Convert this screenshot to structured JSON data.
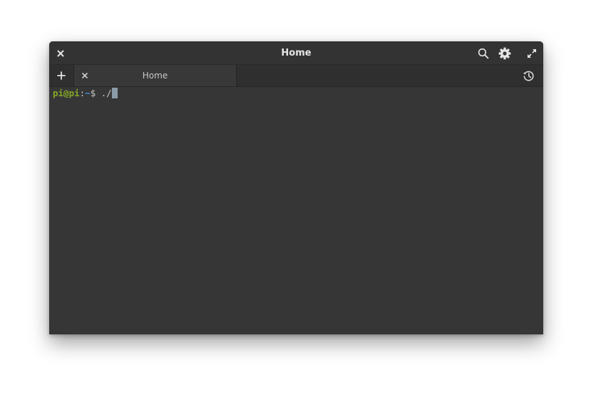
{
  "window": {
    "title": "Home"
  },
  "titlebar": {
    "close_icon": "close-icon",
    "search_icon": "search-icon",
    "settings_icon": "gear-icon",
    "maximize_icon": "maximize-icon"
  },
  "tabbar": {
    "new_tab_icon": "plus-icon",
    "tabs": [
      {
        "label": "Home",
        "close_icon": "close-icon"
      }
    ],
    "history_icon": "history-icon"
  },
  "terminal": {
    "prompt_user": "pi@pi",
    "prompt_colon": ":",
    "prompt_path": "~",
    "prompt_symbol": "$",
    "input": " ./"
  },
  "colors": {
    "background": "#363636",
    "user": "#86a827",
    "path": "#4a8fd0",
    "cursor": "#8a9ba8"
  }
}
